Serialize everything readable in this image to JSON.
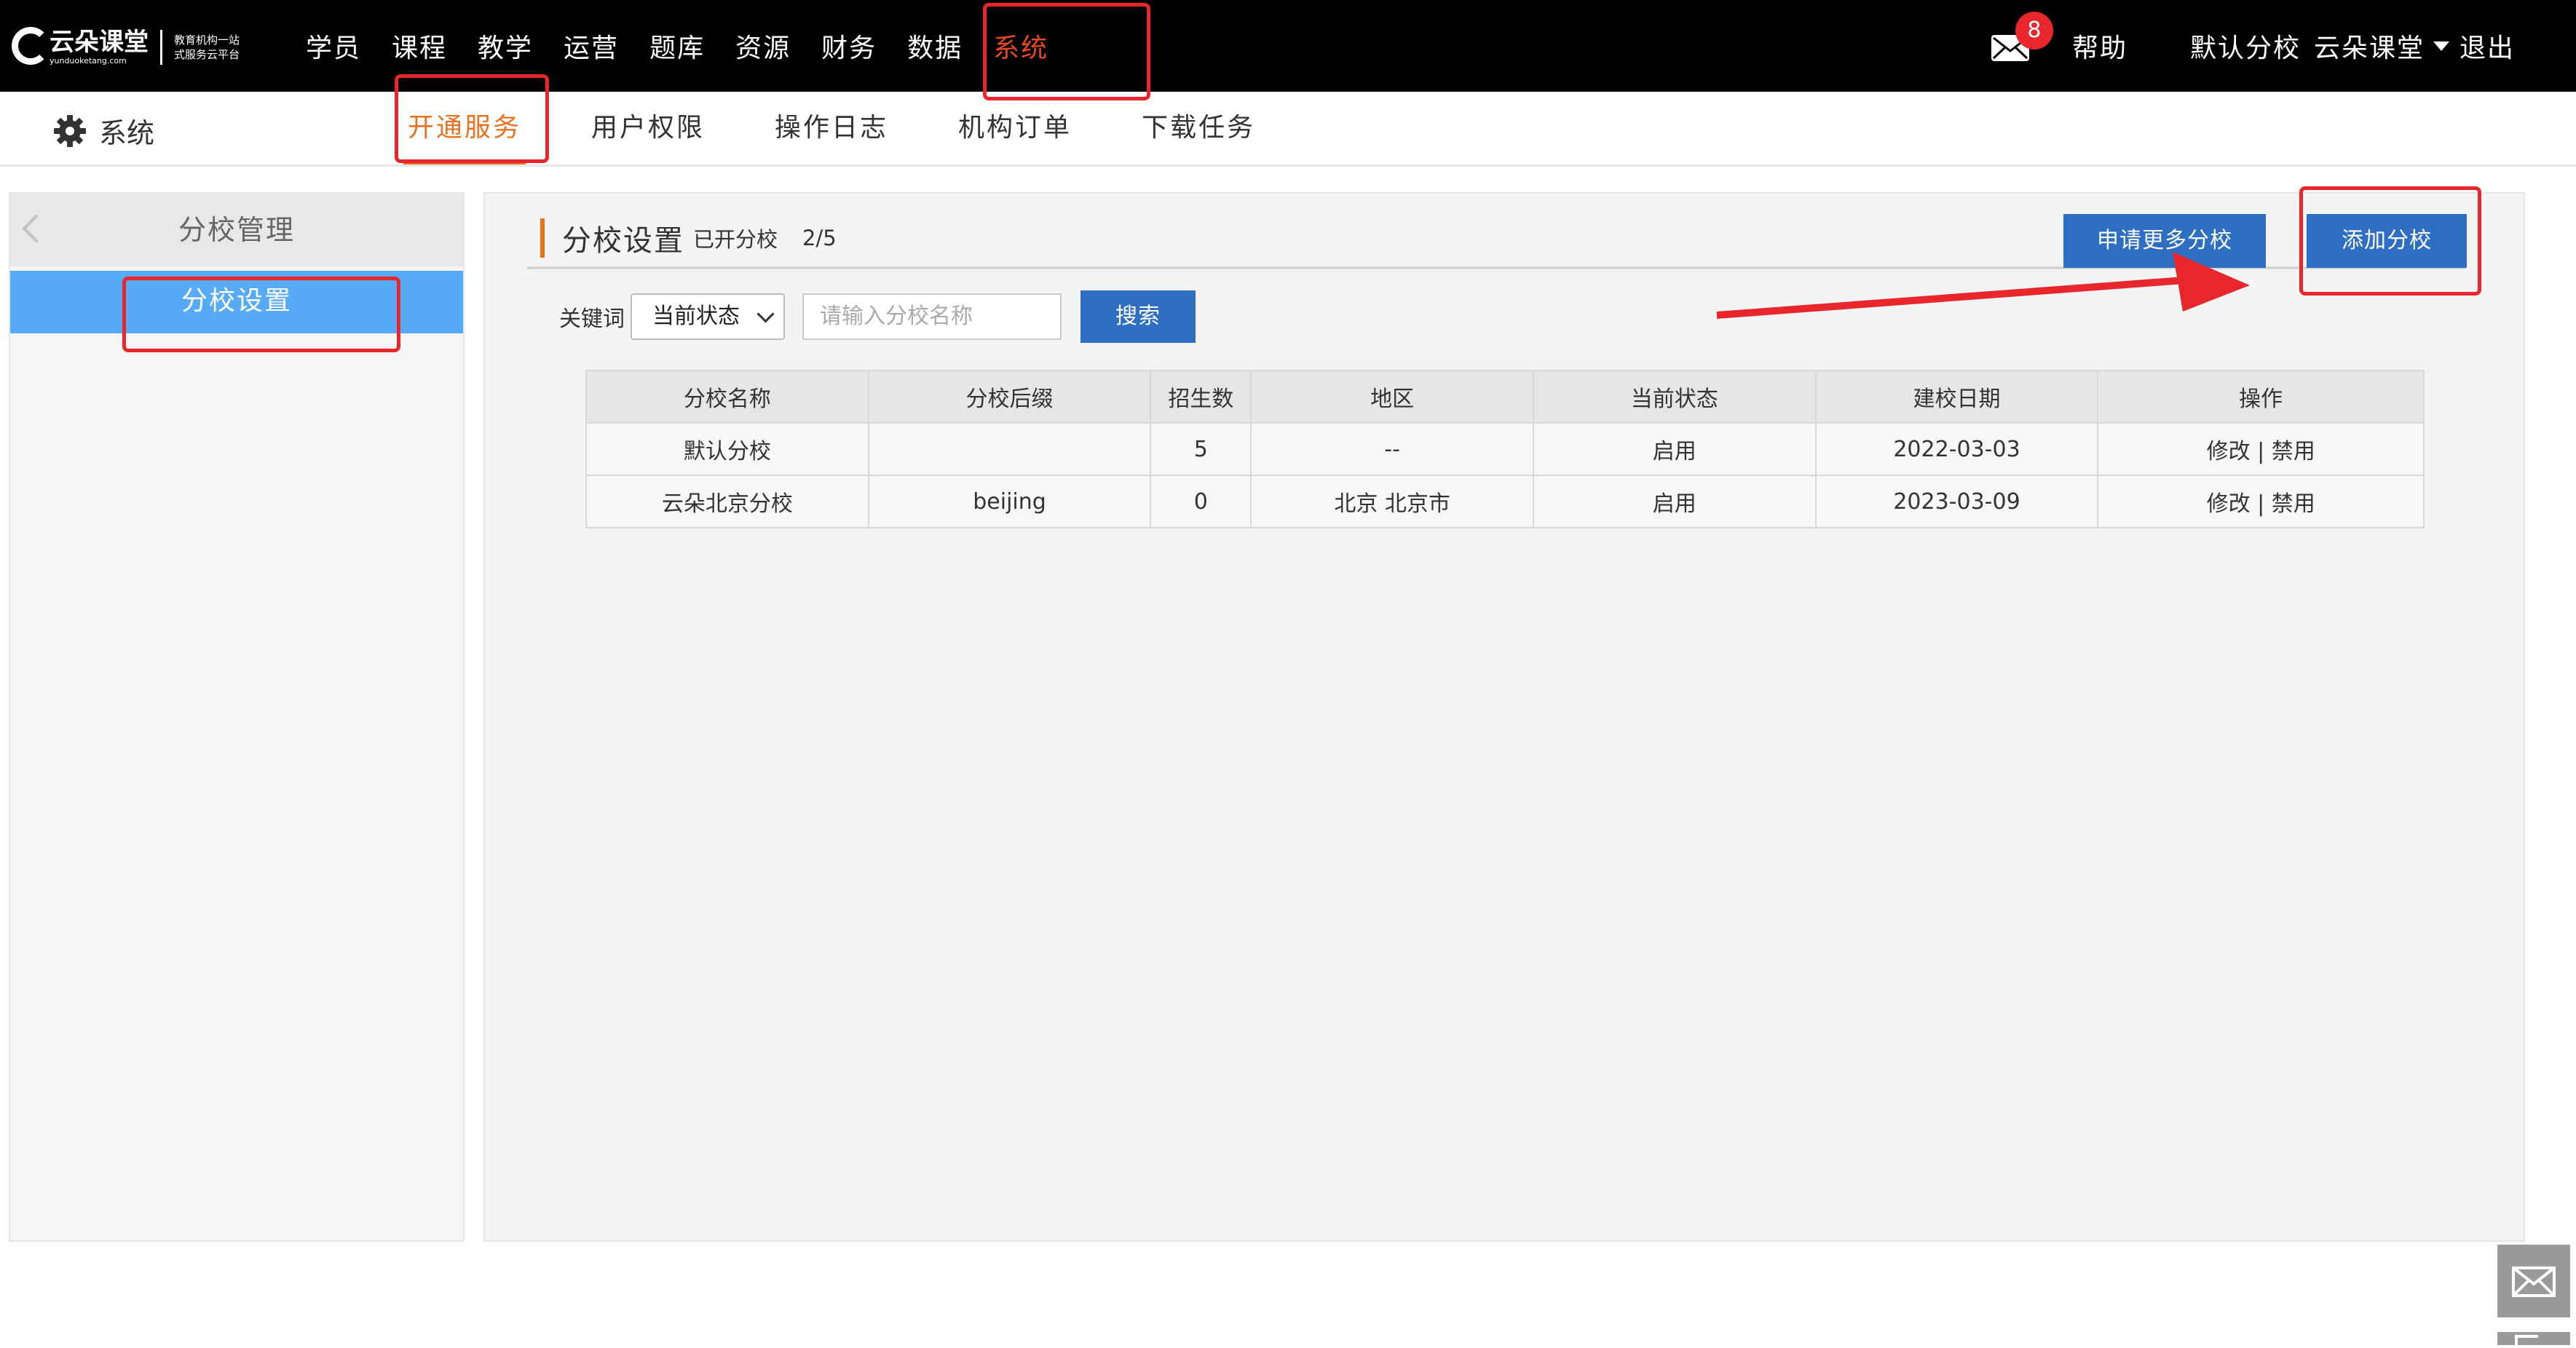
{
  "header": {
    "logo": {
      "name": "云朵课堂",
      "domain": "yunduoketang.com",
      "slogan": "教育机构一站式服务云平台"
    },
    "nav": [
      "学员",
      "课程",
      "教学",
      "运营",
      "题库",
      "资源",
      "财务",
      "数据",
      "系统"
    ],
    "active_nav": "系统",
    "mail_count": "8",
    "help": "帮助",
    "school_label": "默认分校",
    "school_name": "云朵课堂",
    "logout": "退出"
  },
  "subnav": {
    "section_title": "系统",
    "tabs": [
      "开通服务",
      "用户权限",
      "操作日志",
      "机构订单",
      "下载任务"
    ],
    "active_tab": "开通服务"
  },
  "sidebar": {
    "title": "分校管理",
    "items": [
      "分校设置"
    ]
  },
  "main": {
    "title": "分校设置",
    "opened_label": "已开分校",
    "opened_count": "2/5",
    "buttons": {
      "more": "申请更多分校",
      "add": "添加分校"
    },
    "filter": {
      "keyword_label": "关键词",
      "select_value": "当前状态",
      "search_placeholder": "请输入分校名称",
      "search_button": "搜索"
    },
    "table": {
      "headers": [
        "分校名称",
        "分校后缀",
        "招生数",
        "地区",
        "当前状态",
        "建校日期",
        "操作"
      ],
      "rows": [
        [
          "默认分校",
          "",
          "5",
          "--",
          "启用",
          "2022-03-03",
          "修改 | 禁用"
        ],
        [
          "云朵北京分校",
          "beijing",
          "0",
          "北京 北京市",
          "启用",
          "2023-03-09",
          "修改 | 禁用"
        ]
      ]
    }
  },
  "colors": {
    "accent_orange": "#e8721f",
    "annotation_red": "#e8262b",
    "primary_blue": "#2e6fc4",
    "sidebar_active": "#57aaf5"
  }
}
